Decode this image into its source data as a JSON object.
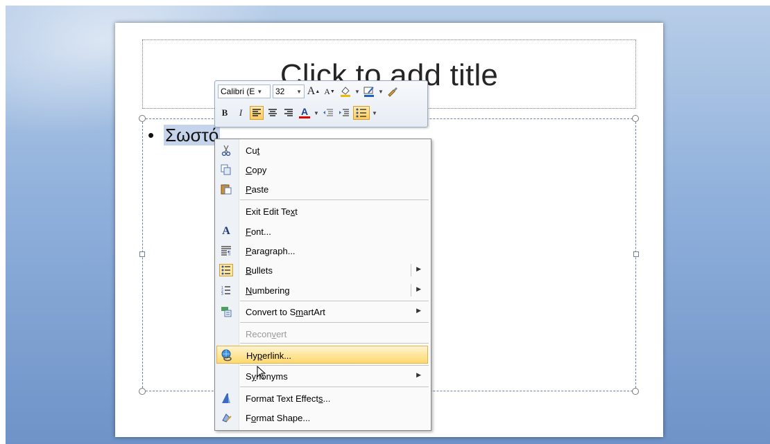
{
  "slide": {
    "title_placeholder": "Click to add title",
    "bullet_text": "Σωστό",
    "bullet_glyph": "•"
  },
  "mini_toolbar": {
    "font_name": "Calibri (E",
    "font_size": "32",
    "grow_font": "A",
    "shrink_font": "A",
    "bold": "B",
    "italic": "I",
    "font_color_letter": "A",
    "accent_fill": "#f0b800",
    "accent_font": "#e00000"
  },
  "context_menu": {
    "items": [
      {
        "label_a": "Cu",
        "label_u": "t",
        "label_b": "",
        "icon": "scissors-icon"
      },
      {
        "label_a": "",
        "label_u": "C",
        "label_b": "opy",
        "icon": "copy-icon"
      },
      {
        "label_a": "",
        "label_u": "P",
        "label_b": "aste",
        "icon": "paste-icon"
      },
      {
        "label_a": "Exit Edit Te",
        "label_u": "x",
        "label_b": "t",
        "icon": ""
      },
      {
        "label_a": "",
        "label_u": "F",
        "label_b": "ont...",
        "icon": "font-icon"
      },
      {
        "label_a": "",
        "label_u": "P",
        "label_b": "aragraph...",
        "icon": "paragraph-icon"
      },
      {
        "label_a": "",
        "label_u": "B",
        "label_b": "ullets",
        "icon": "bullets-icon"
      },
      {
        "label_a": "",
        "label_u": "N",
        "label_b": "umbering",
        "icon": "numbering-icon"
      },
      {
        "label_a": "Convert to S",
        "label_u": "m",
        "label_b": "artArt",
        "icon": "smartart-icon"
      },
      {
        "label_a": "Recon",
        "label_u": "v",
        "label_b": "ert",
        "icon": ""
      },
      {
        "label_a": "Hy",
        "label_u": "p",
        "label_b": "erlink...",
        "icon": "hyperlink-icon"
      },
      {
        "label_a": "S",
        "label_u": "y",
        "label_b": "nonyms",
        "icon": ""
      },
      {
        "label_a": "Format Text Effect",
        "label_u": "s",
        "label_b": "...",
        "icon": "text-effects-icon"
      },
      {
        "label_a": "F",
        "label_u": "o",
        "label_b": "rmat Shape...",
        "icon": "format-shape-icon"
      }
    ],
    "submenu_glyph": "▶"
  }
}
